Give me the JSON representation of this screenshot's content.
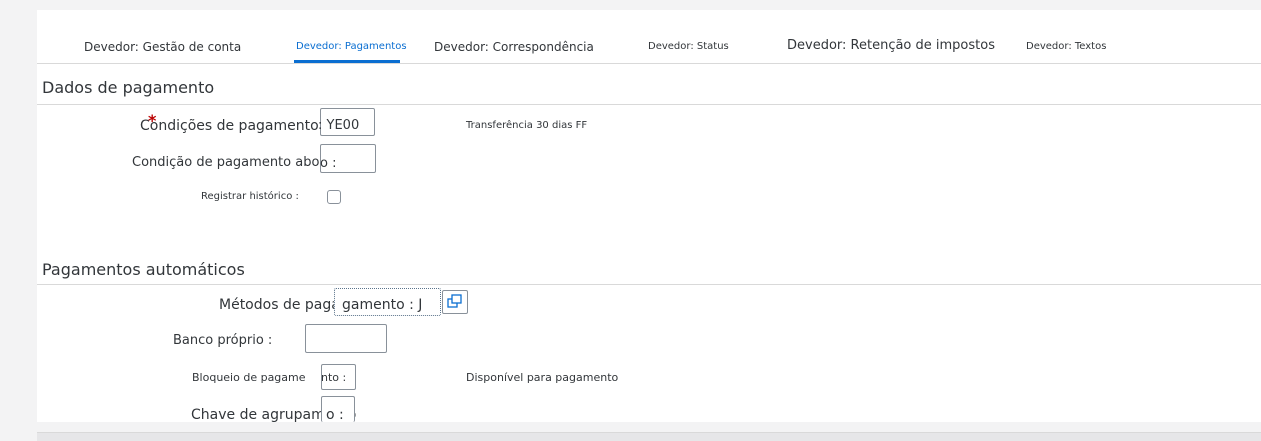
{
  "tabs": [
    {
      "label": "Devedor: Gestão de conta",
      "selected": false
    },
    {
      "label": "Devedor: Pagamentos",
      "selected": true
    },
    {
      "label": "Devedor: Correspondência",
      "selected": false
    },
    {
      "label": "Devedor: Status",
      "selected": false
    },
    {
      "label": "Devedor: Retenção de impostos",
      "selected": false
    },
    {
      "label": "Devedor: Textos",
      "selected": false
    }
  ],
  "payment_data": {
    "title": "Dados de pagamento",
    "terms_label": "Condições de pagamento",
    "terms_value": ": YE00",
    "terms_description": "Transferência 30 dias FF",
    "allowance_label": "Condição de pagamento abono",
    "allowance_value": "o :",
    "history_label": "Registrar histórico :"
  },
  "auto_payments": {
    "title": "Pagamentos automáticos",
    "methods_label": "Métodos de pagamento",
    "methods_value": "gamento : J",
    "house_bank_label": "Banco próprio :",
    "block_label": "Bloqueio de pagame",
    "block_value": "nto :",
    "block_description": "Disponível para pagamento",
    "grouping_label": "Chave de agrupamento",
    "grouping_value": "o :"
  },
  "colors": {
    "accent": "#0a6ed1",
    "required": "#bb0000",
    "border": "#89919a"
  },
  "icons": {
    "required_marker": "asterisk-icon",
    "value_help": "value-help-icon"
  }
}
